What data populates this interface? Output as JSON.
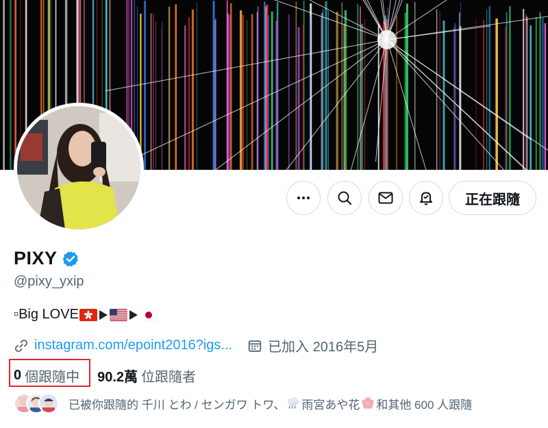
{
  "profile": {
    "display_name": "PIXY",
    "handle": "@pixy_yxip",
    "verified": true,
    "bio": {
      "prefix": "▫Big LOVE",
      "flags": [
        "hong-kong-flag",
        "usa-flag",
        "japan-flag"
      ]
    },
    "website": "instagram.com/epoint2016?igs...",
    "joined": "已加入 2016年5月",
    "following_count": "0",
    "following_label": "個跟隨中",
    "followers_count": "90.2萬",
    "followers_label": "位跟隨者",
    "mutuals": {
      "prefix": "已被你跟隨的 千川 とわ / センガワ トワ、",
      "middle": "雨宮あや花",
      "suffix": "和其他 600 人跟隨"
    }
  },
  "actions": {
    "more": "more-icon",
    "search": "search-icon",
    "message": "mail-icon",
    "notify": "bell-icon",
    "follow_label": "正在跟隨"
  },
  "colors": {
    "accent": "#1d9bf0",
    "highlight": "#e0262b",
    "muted": "#536471"
  }
}
